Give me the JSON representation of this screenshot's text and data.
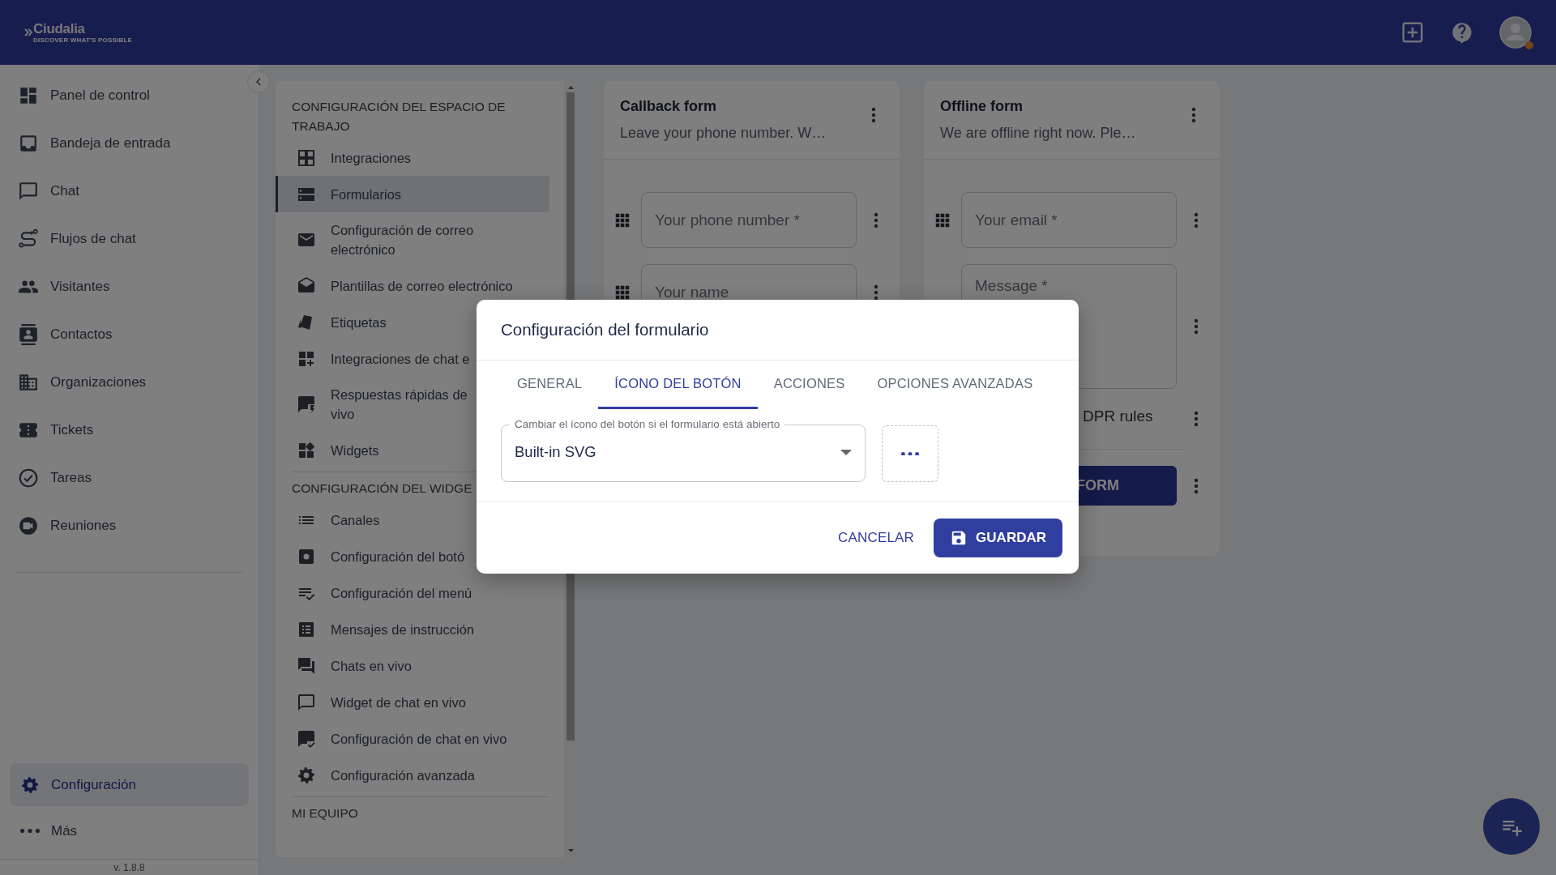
{
  "app_bar": {
    "logo": "Ciudalia",
    "tagline": "DISCOVER WHAT'S POSSIBLE"
  },
  "sidebar": {
    "items": [
      {
        "label": "Panel de control",
        "selected": false
      },
      {
        "label": "Bandeja de entrada",
        "selected": false
      },
      {
        "label": "Chat",
        "selected": false
      },
      {
        "label": "Flujos de chat",
        "selected": false
      },
      {
        "label": "Visitantes",
        "selected": false
      },
      {
        "label": "Contactos",
        "selected": false
      },
      {
        "label": "Organizaciones",
        "selected": false
      },
      {
        "label": "Tickets",
        "selected": false
      },
      {
        "label": "Tareas",
        "selected": false
      },
      {
        "label": "Reuniones",
        "selected": false
      }
    ],
    "footer_items": [
      {
        "label": "Configuración",
        "selected": true
      },
      {
        "label": "Más",
        "selected": false
      }
    ],
    "version": "v. 1.8.8"
  },
  "settings_menu": {
    "sections": [
      {
        "title": "CONFIGURACIÓN DEL ESPACIO DE TRABAJO",
        "items": [
          {
            "label": "Integraciones",
            "selected": false
          },
          {
            "label": "Formularios",
            "selected": true
          },
          {
            "label": "Configuración de correo\nelectrónico",
            "selected": false
          },
          {
            "label": "Plantillas de correo electrónico",
            "selected": false
          },
          {
            "label": "Etiquetas",
            "selected": false
          },
          {
            "label": "Integraciones de chat e",
            "selected": false
          },
          {
            "label": "Respuestas rápidas de\nvivo",
            "selected": false
          },
          {
            "label": "Widgets",
            "selected": false
          }
        ]
      },
      {
        "title": "CONFIGURACIÓN DEL WIDGE",
        "items": [
          {
            "label": "Canales",
            "selected": false
          },
          {
            "label": "Configuración del botó",
            "selected": false
          },
          {
            "label": "Configuración del menú",
            "selected": false
          },
          {
            "label": "Mensajes de instrucción",
            "selected": false
          },
          {
            "label": "Chats en vivo",
            "selected": false
          },
          {
            "label": "Widget de chat en vivo",
            "selected": false
          },
          {
            "label": "Configuración de chat en vivo",
            "selected": false
          },
          {
            "label": "Configuración avanzada",
            "selected": false
          }
        ]
      },
      {
        "title": "MI EQUIPO"
      }
    ]
  },
  "forms": [
    {
      "title": "Callback form",
      "description": "Leave your phone number. W…",
      "fields": [
        {
          "kind": "input",
          "placeholder": "Your phone number *"
        },
        {
          "kind": "input",
          "placeholder": "Your name"
        }
      ]
    },
    {
      "title": "Offline form",
      "description": "We are offline right now. Ple…",
      "fields": [
        {
          "kind": "input",
          "placeholder": "Your email *"
        },
        {
          "kind": "textarea",
          "placeholder": "Message *"
        },
        {
          "kind": "consent",
          "label": "DPR rules"
        },
        {
          "kind": "button",
          "label": "FORM"
        }
      ]
    }
  ],
  "dialog": {
    "title": "Configuración del formulario",
    "tabs": [
      {
        "label": "GENERAL",
        "selected": false
      },
      {
        "label": "ÍCONO DEL BOTÓN",
        "selected": true
      },
      {
        "label": "ACCIONES",
        "selected": false
      },
      {
        "label": "OPCIONES AVANZADAS",
        "selected": false
      }
    ],
    "select": {
      "label": "Cambiar el ícono del botón si el formulario está abierto",
      "value": "Built-in SVG"
    },
    "buttons": [
      {
        "kind": "text",
        "label": "CANCELAR"
      },
      {
        "kind": "primary",
        "label": "GUARDAR"
      }
    ]
  }
}
